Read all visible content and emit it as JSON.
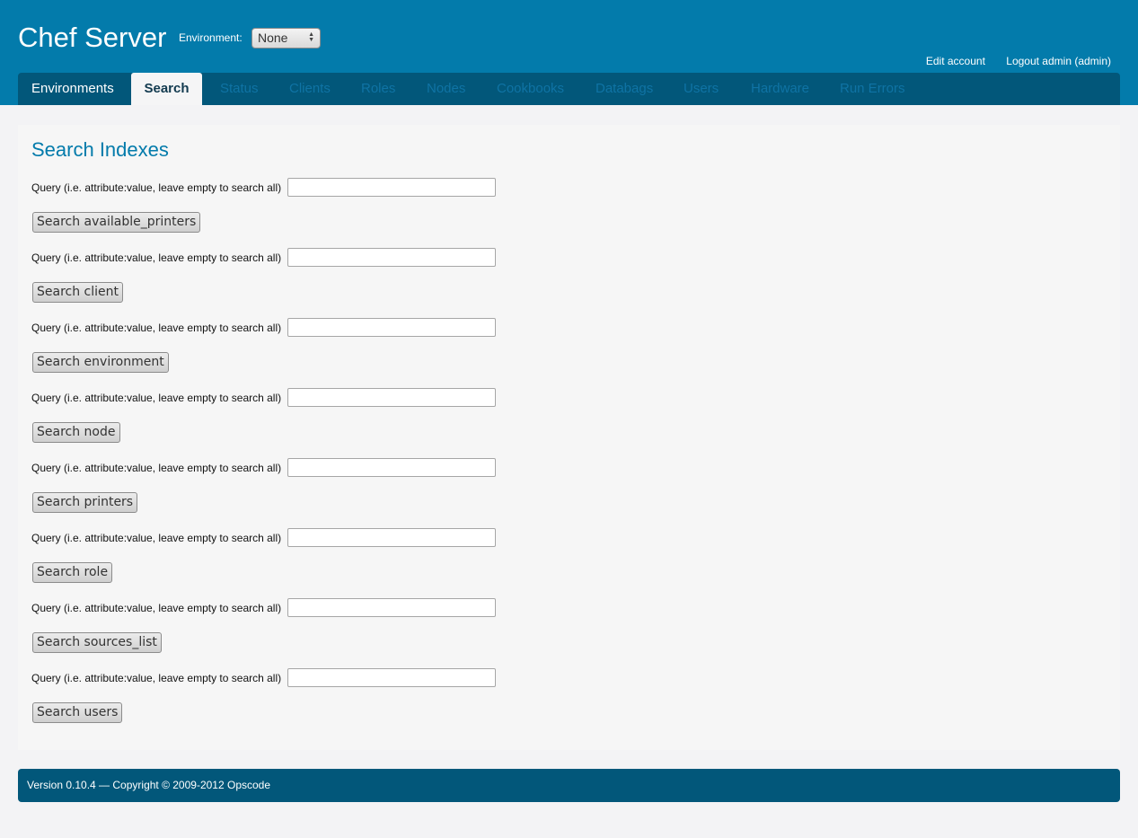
{
  "header": {
    "app_title": "Chef Server",
    "environment_label": "Environment:",
    "environment_value": "None",
    "edit_account": "Edit account",
    "logout": "Logout admin (admin)"
  },
  "nav": {
    "items": [
      {
        "label": "Environments"
      },
      {
        "label": "Search"
      },
      {
        "label": "Status"
      },
      {
        "label": "Clients"
      },
      {
        "label": "Roles"
      },
      {
        "label": "Nodes"
      },
      {
        "label": "Cookbooks"
      },
      {
        "label": "Databags"
      },
      {
        "label": "Users"
      },
      {
        "label": "Hardware"
      },
      {
        "label": "Run Errors"
      }
    ],
    "active": "Search"
  },
  "main": {
    "title": "Search Indexes",
    "query_label": "Query (i.e. attribute:value, leave empty to search all)",
    "indexes": [
      {
        "button_label": "Search available_printers",
        "query_value": ""
      },
      {
        "button_label": "Search client",
        "query_value": ""
      },
      {
        "button_label": "Search environment",
        "query_value": ""
      },
      {
        "button_label": "Search node",
        "query_value": ""
      },
      {
        "button_label": "Search printers",
        "query_value": ""
      },
      {
        "button_label": "Search role",
        "query_value": ""
      },
      {
        "button_label": "Search sources_list",
        "query_value": ""
      },
      {
        "button_label": "Search users",
        "query_value": ""
      }
    ]
  },
  "footer": {
    "text": "Version 0.10.4 — Copyright © 2009-2012 Opscode"
  },
  "colors": {
    "header_bg": "#037bab",
    "nav_bg": "#02577a",
    "title_color": "#037bab",
    "nav_inactive_text": "#0f73a4"
  }
}
